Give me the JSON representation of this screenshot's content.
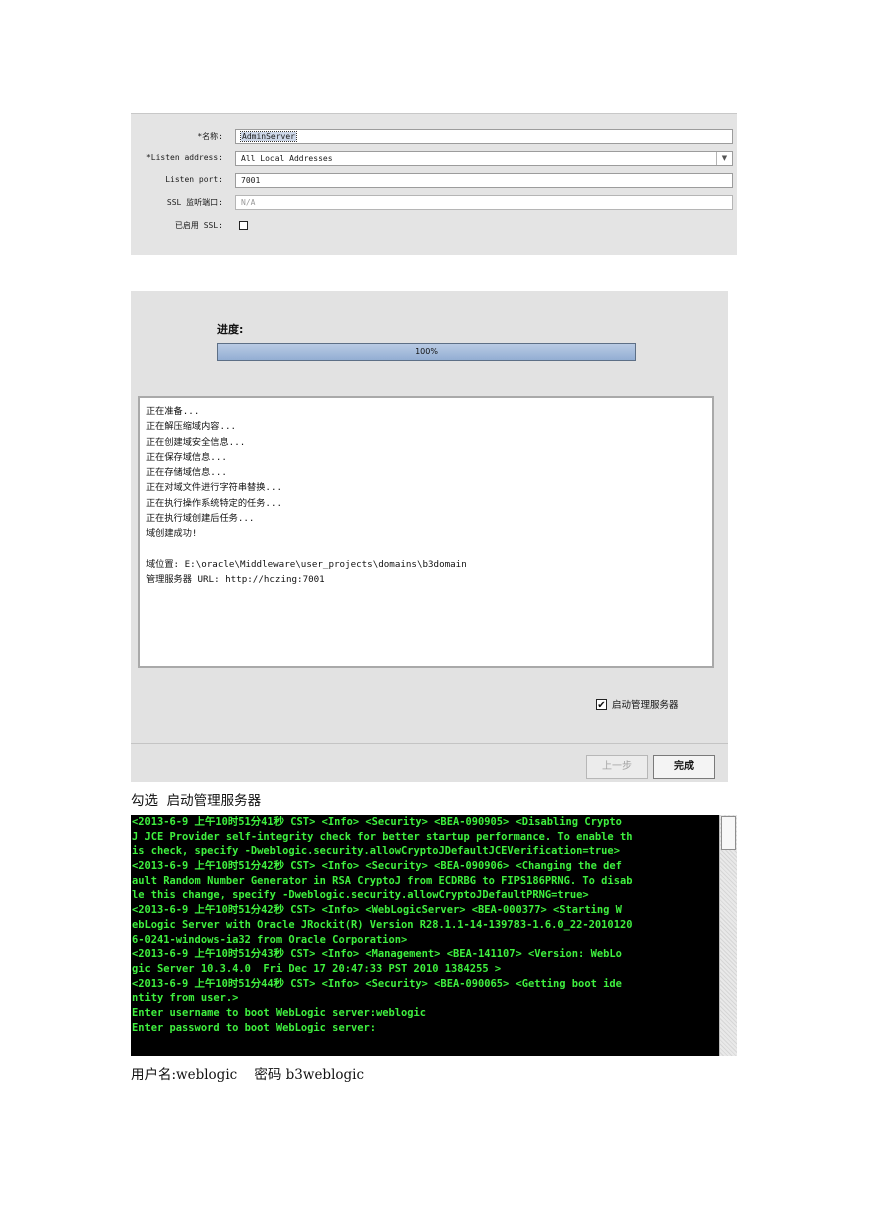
{
  "server_form": {
    "name_label": "*名称:",
    "name_value": "AdminServer",
    "listen_address_label": "*Listen address:",
    "listen_address_value": "All Local Addresses",
    "listen_port_label": "Listen port:",
    "listen_port_value": "7001",
    "ssl_port_label": "SSL 监听端口:",
    "ssl_port_value": "N/A",
    "ssl_enabled_label": "已启用 SSL:",
    "ssl_enabled": false
  },
  "progress_dialog": {
    "progress_label": "进度:",
    "progress_percent": 100,
    "progress_text": "100%",
    "log_lines": [
      "正在准备...",
      "正在解压缩域内容...",
      "正在创建域安全信息...",
      "正在保存域信息...",
      "正在存储域信息...",
      "正在对域文件进行字符串替换...",
      "正在执行操作系统特定的任务...",
      "正在执行域创建后任务...",
      "域创建成功!",
      "",
      "域位置: E:\\oracle\\Middleware\\user_projects\\domains\\b3domain",
      "管理服务器 URL: http://hczing:7001"
    ],
    "start_admin_label": "启动管理服务器",
    "start_admin_checked": true,
    "check_mark": "✔",
    "prev_button": "上一步",
    "finish_button": "完成"
  },
  "caption_1": "勾选  启动管理服务器",
  "console_lines": [
    "<2013-6-9 上午10时51分41秒 CST> <Info> <Security> <BEA-090905> <Disabling Crypto",
    "J JCE Provider self-integrity check for better startup performance. To enable th",
    "is check, specify -Dweblogic.security.allowCryptoJDefaultJCEVerification=true>",
    "<2013-6-9 上午10时51分42秒 CST> <Info> <Security> <BEA-090906> <Changing the def",
    "ault Random Number Generator in RSA CryptoJ from ECDRBG to FIPS186PRNG. To disab",
    "le this change, specify -Dweblogic.security.allowCryptoJDefaultPRNG=true>",
    "<2013-6-9 上午10时51分42秒 CST> <Info> <WebLogicServer> <BEA-000377> <Starting W",
    "ebLogic Server with Oracle JRockit(R) Version R28.1.1-14-139783-1.6.0_22-2010120",
    "6-0241-windows-ia32 from Oracle Corporation>",
    "<2013-6-9 上午10时51分43秒 CST> <Info> <Management> <BEA-141107> <Version: WebLo",
    "gic Server 10.3.4.0  Fri Dec 17 20:47:33 PST 2010 1384255 >",
    "<2013-6-9 上午10时51分44秒 CST> <Info> <Security> <BEA-090065> <Getting boot ide",
    "ntity from user.>",
    "Enter username to boot WebLogic server:weblogic",
    "Enter password to boot WebLogic server:"
  ],
  "caption_2": "用户名:weblogic    密码 b3weblogic",
  "colors": {
    "console_text": "#3ff03f",
    "console_bg": "#000000",
    "panel_bg": "#e2e2e2",
    "progress_fill": "#93aed3"
  },
  "icons": {
    "dropdown": "chevron-down-icon",
    "checkbox": "checkbox-icon"
  }
}
